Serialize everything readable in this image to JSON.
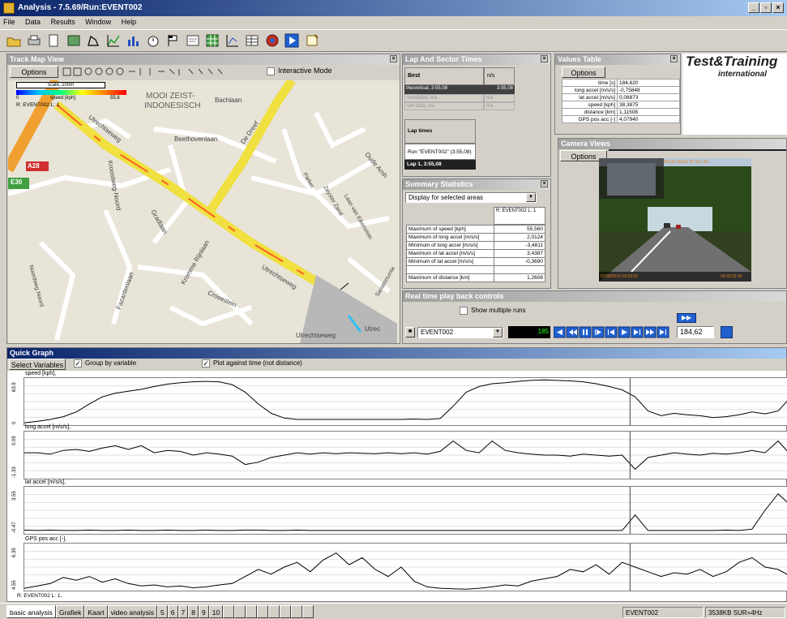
{
  "app": {
    "title": "Analysis - 7.5.69/Run:EVENT002"
  },
  "menu": [
    "File",
    "Data",
    "Results",
    "Window",
    "Help"
  ],
  "colors": {
    "title_bar": "#0a246a",
    "track_line": "#f0e040",
    "map_bg": "#e8e4d8"
  },
  "track_map": {
    "title": "Track Map View",
    "options": "Options",
    "interactive_mode": "Interactive Mode",
    "scale": "scale, 200m",
    "speed_min": "0",
    "speed_label": "speed [kph]",
    "speed_max": "55,6",
    "run_label": "R: EVENT002 L: 1",
    "map_labels": {
      "mooi": "MOOI ZEIST-",
      "indo": "INDONESISCH",
      "bachlaan": "Bachlaan",
      "beethoven": "Beethovenlaan",
      "dreef": "De Dreef",
      "utrecht1": "Utrechtseweg",
      "utrecht2": "Utrechtseweg",
      "utrecht3": "Utrechtseweg",
      "oude": "Oude Arnh",
      "grad": "Gradlaan",
      "kroost": "Kroostweg-Noord",
      "krommerijn": "Kromme Rijnlaan",
      "fazanten": "Fazantenlaan",
      "crosestein": "Crosestein",
      "laan": "Laan van Eikenstein",
      "zeyster": "Zeyster Zand",
      "a28": "A28",
      "e30": "E30",
      "nooms": "Noordweg Noord",
      "utr_end": "Utrec",
      "parker": "Parker",
      "sans": "Sanatoriumla"
    }
  },
  "lap": {
    "title": "Lap And Sector Times",
    "col_best": "Best",
    "col_ns": "n/s",
    "rows": [
      {
        "name": "theoretical, 3:55,08",
        "val": "3:55,08"
      },
      {
        "name": "simulated, n/a",
        "val": "n/a"
      },
      {
        "name": "sim data, n/a",
        "val": "n/a"
      }
    ],
    "lap_times_label": "Lap times",
    "run": "Run \"EVENT002\" (3:55,08)",
    "lap1": "Lap 1, 3:55,08"
  },
  "values_table": {
    "title": "Values Table",
    "options": "Options",
    "rows": [
      {
        "name": "time [s]",
        "val": "184,620"
      },
      {
        "name": "long accel [m/s/s]",
        "val": "-0,75848"
      },
      {
        "name": "lat accel [m/s/s]",
        "val": "0,08873"
      },
      {
        "name": "speed [kph]",
        "val": "38,3875"
      },
      {
        "name": "distance [km]",
        "val": "1,11508"
      },
      {
        "name": "GPS pos acc [-]",
        "val": "4,07940"
      }
    ]
  },
  "logo": {
    "line1": "Test&Training",
    "line2": "international"
  },
  "camera": {
    "title": "Camera Views",
    "options": "Options",
    "overlay_top": "80 kph   long% 57   lat 1.03",
    "ts_left": "07/09/2010   09:33:20",
    "ts_right": "09:33:32.00"
  },
  "summary": {
    "title": "Summary Statistics",
    "dropdown": "Display for selected areas",
    "col_header": "R: EVENT002 L: 1",
    "rows": [
      {
        "name": "Maximum of speed [kph]",
        "val": "55,560"
      },
      {
        "name": "Maximum of long accel [m/s/s]",
        "val": "2,0124"
      },
      {
        "name": "Minimum of long accel [m/s/s]",
        "val": "-3,4811"
      },
      {
        "name": "Maximum of lat accel [m/s/s]",
        "val": "3,4387"
      },
      {
        "name": "Minimum of lat accel [m/s/s]",
        "val": "-0,3690"
      },
      {
        "name": "Maximum of distance [km]",
        "val": "1,2608"
      }
    ]
  },
  "playback": {
    "title": "Real time play back controls",
    "show_multiple": "Show multiple runs",
    "event": "EVENT002",
    "counter": "185",
    "time": "184,62"
  },
  "quick_graph": {
    "title": "Quick Graph",
    "select": "Select Variables",
    "group": "Group by variable",
    "plot_time": "Plot against time (not distance)",
    "footer": "R: EVENT002 L: 1,"
  },
  "graphs": [
    {
      "label": "speed [kph],",
      "ymax": "63.9",
      "ymin": "0",
      "values": [
        0.05,
        0.08,
        0.12,
        0.18,
        0.28,
        0.45,
        0.6,
        0.68,
        0.72,
        0.76,
        0.82,
        0.87,
        0.9,
        0.92,
        0.93,
        0.92,
        0.86,
        0.7,
        0.45,
        0.25,
        0.15,
        0.12,
        0.12,
        0.12,
        0.12,
        0.12,
        0.12,
        0.12,
        0.12,
        0.12,
        0.13,
        0.12,
        0.14,
        0.4,
        0.7,
        0.82,
        0.88,
        0.9,
        0.93,
        0.95,
        0.96,
        0.95,
        0.94,
        0.92,
        0.88,
        0.82,
        0.75,
        0.6,
        0.3,
        0.2,
        0.25,
        0.22,
        0.2,
        0.16,
        0.18,
        0.22,
        0.28,
        0.24,
        0.3,
        0.6
      ]
    },
    {
      "label": "long accel [m/s/s],",
      "ymax": "0.09",
      "ymin": "-1.33",
      "values": [
        0.55,
        0.55,
        0.52,
        0.6,
        0.62,
        0.58,
        0.65,
        0.7,
        0.62,
        0.7,
        0.55,
        0.6,
        0.58,
        0.5,
        0.55,
        0.52,
        0.48,
        0.3,
        0.35,
        0.45,
        0.5,
        0.55,
        0.52,
        0.55,
        0.53,
        0.55,
        0.54,
        0.53,
        0.55,
        0.53,
        0.55,
        0.52,
        0.58,
        0.8,
        0.6,
        0.55,
        0.8,
        0.6,
        0.55,
        0.52,
        0.5,
        0.5,
        0.48,
        0.52,
        0.5,
        0.48,
        0.5,
        0.2,
        0.45,
        0.5,
        0.55,
        0.52,
        0.5,
        0.54,
        0.52,
        0.55,
        0.6,
        0.55,
        0.8,
        0.5
      ]
    },
    {
      "label": "lat accel [m/s/s],",
      "ymax": "3.55",
      "ymin": "-0.47",
      "values": [
        0.08,
        0.07,
        0.08,
        0.07,
        0.07,
        0.08,
        0.07,
        0.07,
        0.08,
        0.07,
        0.07,
        0.08,
        0.07,
        0.07,
        0.08,
        0.07,
        0.07,
        0.08,
        0.08,
        0.07,
        0.07,
        0.08,
        0.07,
        0.07,
        0.07,
        0.07,
        0.07,
        0.07,
        0.07,
        0.07,
        0.07,
        0.07,
        0.07,
        0.07,
        0.07,
        0.07,
        0.07,
        0.07,
        0.07,
        0.07,
        0.07,
        0.07,
        0.07,
        0.07,
        0.07,
        0.07,
        0.07,
        0.4,
        0.07,
        0.07,
        0.07,
        0.07,
        0.07,
        0.07,
        0.08,
        0.07,
        0.1,
        0.5,
        0.85,
        0.6
      ]
    },
    {
      "label": "GPS pos acc [-],",
      "ymax": "6.35",
      "ymin": "4.55",
      "values": [
        0.05,
        0.1,
        0.15,
        0.28,
        0.22,
        0.3,
        0.18,
        0.25,
        0.15,
        0.1,
        0.12,
        0.08,
        0.1,
        0.06,
        0.08,
        0.12,
        0.15,
        0.3,
        0.45,
        0.35,
        0.5,
        0.6,
        0.4,
        0.65,
        0.8,
        0.55,
        0.7,
        0.45,
        0.3,
        0.5,
        0.2,
        0.08,
        0.05,
        0.04,
        0.03,
        0.05,
        0.08,
        0.12,
        0.1,
        0.2,
        0.25,
        0.3,
        0.45,
        0.4,
        0.55,
        0.35,
        0.6,
        0.5,
        0.4,
        0.3,
        0.38,
        0.35,
        0.45,
        0.3,
        0.4,
        0.6,
        0.7,
        0.5,
        0.45,
        0.3
      ]
    }
  ],
  "bottom_tabs": [
    "basic analysis",
    "Grafiek",
    "Kaart",
    "video analysis",
    "5",
    "6",
    "7",
    "8",
    "9",
    "10",
    "",
    "",
    "",
    "",
    "",
    "",
    "",
    ""
  ],
  "status": {
    "event": "EVENT002",
    "info": "3538KB SUR=4Hz"
  }
}
